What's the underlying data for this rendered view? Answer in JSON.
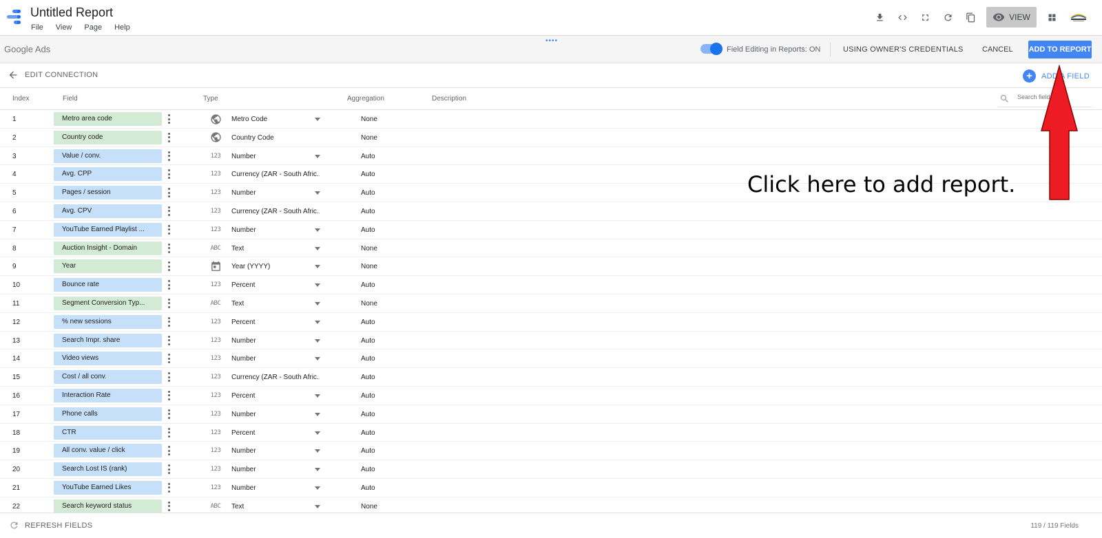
{
  "app": {
    "title": "Untitled Report",
    "menu": [
      "File",
      "View",
      "Page",
      "Help"
    ],
    "view_button": "VIEW"
  },
  "connection": {
    "name": "Google Ads",
    "field_editing_label": "Field Editing in Reports: ON",
    "credentials_button": "USING OWNER'S CREDENTIALS",
    "cancel_button": "CANCEL",
    "add_to_report_button": "ADD TO REPORT"
  },
  "edit": {
    "label": "EDIT CONNECTION",
    "add_field_label": "ADD A FIELD"
  },
  "columns": {
    "index": "Index",
    "field": "Field",
    "type": "Type",
    "aggregation": "Aggregation",
    "description": "Description"
  },
  "search": {
    "placeholder": "Search fields"
  },
  "colors": {
    "accent": "#4285f4",
    "dimension_chip": "#d3ead4",
    "metric_chip": "#c6e0fa",
    "annotation_arrow": "#ed1c24"
  },
  "rows": [
    {
      "index": "1",
      "field": "Metro area code",
      "kind": "dimension",
      "type_icon": "globe-icon",
      "type": "Metro Code",
      "caret": true,
      "aggregation": "None"
    },
    {
      "index": "2",
      "field": "Country code",
      "kind": "dimension",
      "type_icon": "globe-icon",
      "type": "Country Code",
      "caret": false,
      "aggregation": "None"
    },
    {
      "index": "3",
      "field": "Value / conv.",
      "kind": "metric",
      "type_icon": "123",
      "type": "Number",
      "caret": true,
      "aggregation": "Auto"
    },
    {
      "index": "4",
      "field": "Avg. CPP",
      "kind": "metric",
      "type_icon": "123",
      "type": "Currency (ZAR - South Afric...",
      "caret": false,
      "aggregation": "Auto"
    },
    {
      "index": "5",
      "field": "Pages / session",
      "kind": "metric",
      "type_icon": "123",
      "type": "Number",
      "caret": true,
      "aggregation": "Auto"
    },
    {
      "index": "6",
      "field": "Avg. CPV",
      "kind": "metric",
      "type_icon": "123",
      "type": "Currency (ZAR - South Afric...",
      "caret": false,
      "aggregation": "Auto"
    },
    {
      "index": "7",
      "field": "YouTube Earned Playlist ...",
      "kind": "metric",
      "type_icon": "123",
      "type": "Number",
      "caret": true,
      "aggregation": "Auto"
    },
    {
      "index": "8",
      "field": "Auction Insight - Domain",
      "kind": "dimension",
      "type_icon": "ABC",
      "type": "Text",
      "caret": true,
      "aggregation": "None"
    },
    {
      "index": "9",
      "field": "Year",
      "kind": "dimension",
      "type_icon": "calendar-icon",
      "type": "Year (YYYY)",
      "caret": true,
      "aggregation": "None"
    },
    {
      "index": "10",
      "field": "Bounce rate",
      "kind": "metric",
      "type_icon": "123",
      "type": "Percent",
      "caret": true,
      "aggregation": "Auto"
    },
    {
      "index": "11",
      "field": "Segment Conversion Typ...",
      "kind": "dimension",
      "type_icon": "ABC",
      "type": "Text",
      "caret": true,
      "aggregation": "None"
    },
    {
      "index": "12",
      "field": "% new sessions",
      "kind": "metric",
      "type_icon": "123",
      "type": "Percent",
      "caret": true,
      "aggregation": "Auto"
    },
    {
      "index": "13",
      "field": "Search Impr. share",
      "kind": "metric",
      "type_icon": "123",
      "type": "Number",
      "caret": true,
      "aggregation": "Auto"
    },
    {
      "index": "14",
      "field": "Video views",
      "kind": "metric",
      "type_icon": "123",
      "type": "Number",
      "caret": true,
      "aggregation": "Auto"
    },
    {
      "index": "15",
      "field": "Cost / all conv.",
      "kind": "metric",
      "type_icon": "123",
      "type": "Currency (ZAR - South Afric...",
      "caret": false,
      "aggregation": "Auto"
    },
    {
      "index": "16",
      "field": "Interaction Rate",
      "kind": "metric",
      "type_icon": "123",
      "type": "Percent",
      "caret": true,
      "aggregation": "Auto"
    },
    {
      "index": "17",
      "field": "Phone calls",
      "kind": "metric",
      "type_icon": "123",
      "type": "Number",
      "caret": true,
      "aggregation": "Auto"
    },
    {
      "index": "18",
      "field": "CTR",
      "kind": "metric",
      "type_icon": "123",
      "type": "Percent",
      "caret": true,
      "aggregation": "Auto"
    },
    {
      "index": "19",
      "field": "All conv. value / click",
      "kind": "metric",
      "type_icon": "123",
      "type": "Number",
      "caret": true,
      "aggregation": "Auto"
    },
    {
      "index": "20",
      "field": "Search Lost IS (rank)",
      "kind": "metric",
      "type_icon": "123",
      "type": "Number",
      "caret": true,
      "aggregation": "Auto"
    },
    {
      "index": "21",
      "field": "YouTube Earned Likes",
      "kind": "metric",
      "type_icon": "123",
      "type": "Number",
      "caret": true,
      "aggregation": "Auto"
    },
    {
      "index": "22",
      "field": "Search keyword status",
      "kind": "dimension",
      "type_icon": "ABC",
      "type": "Text",
      "caret": true,
      "aggregation": "None"
    }
  ],
  "footer": {
    "refresh_label": "REFRESH FIELDS",
    "field_count": "119 / 119 Fields"
  },
  "annotation": {
    "text": "Click here to add report."
  }
}
